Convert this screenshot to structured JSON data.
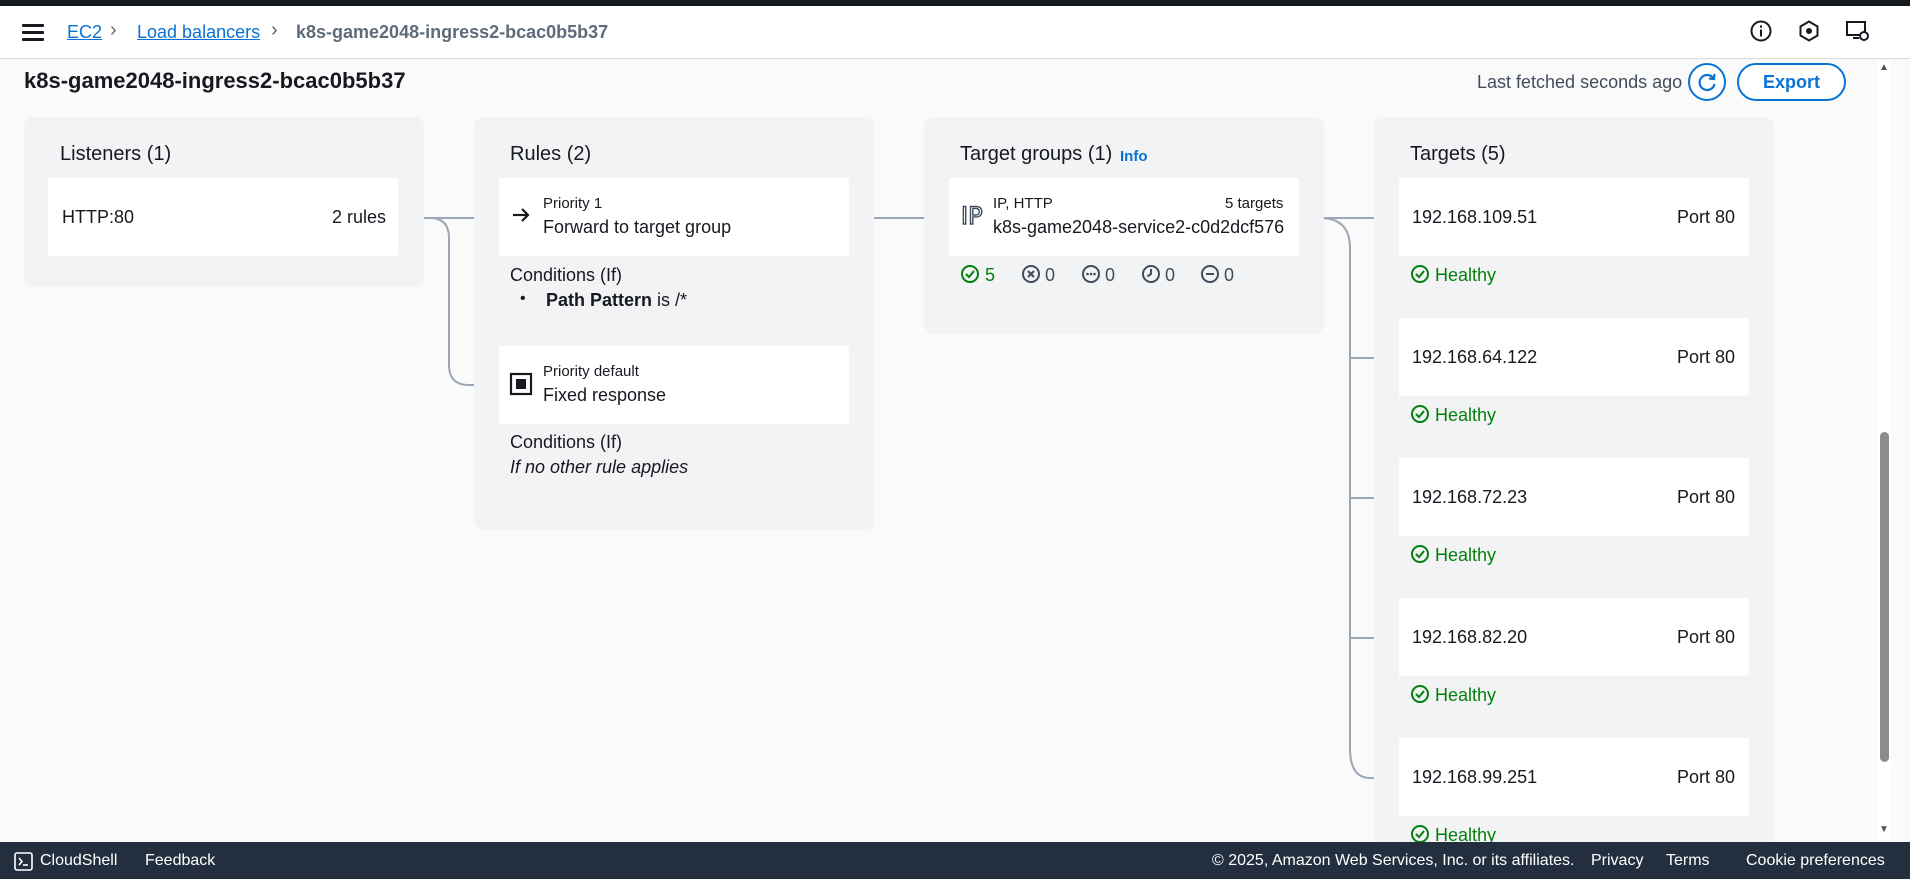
{
  "breadcrumb": {
    "items": [
      "EC2",
      "Load balancers"
    ],
    "current": "k8s-game2048-ingress2-bcac0b5b37"
  },
  "header": {
    "title": "k8s-game2048-ingress2-bcac0b5b37",
    "fetched": "Last fetched seconds ago",
    "export_label": "Export"
  },
  "listeners": {
    "title": "Listeners (1)",
    "items": [
      {
        "protocol": "HTTP:80",
        "rules": "2 rules"
      }
    ]
  },
  "rules": {
    "title": "Rules (2)",
    "items": [
      {
        "priority": "Priority 1",
        "action": "Forward to target group",
        "conditions_title": "Conditions (If)",
        "condition_key": "Path Pattern",
        "condition_op": " is /*"
      },
      {
        "priority": "Priority default",
        "action": "Fixed response",
        "conditions_title": "Conditions (If)",
        "condition_text": "If no other rule applies"
      }
    ]
  },
  "target_groups": {
    "title": "Target groups (1)",
    "info": "Info",
    "items": [
      {
        "type": "IP, HTTP",
        "count": "5 targets",
        "name": "k8s-game2048-service2-c0d2dcf576",
        "icon_text": "IP",
        "status_counts": {
          "healthy": "5",
          "unhealthy": "0",
          "unused": "0",
          "draining": "0",
          "unavailable": "0"
        }
      }
    ]
  },
  "targets": {
    "title": "Targets (5)",
    "items": [
      {
        "ip": "192.168.109.51",
        "port": "Port 80",
        "status": "Healthy"
      },
      {
        "ip": "192.168.64.122",
        "port": "Port 80",
        "status": "Healthy"
      },
      {
        "ip": "192.168.72.23",
        "port": "Port 80",
        "status": "Healthy"
      },
      {
        "ip": "192.168.82.20",
        "port": "Port 80",
        "status": "Healthy"
      },
      {
        "ip": "192.168.99.251",
        "port": "Port 80",
        "status": "Healthy"
      }
    ]
  },
  "footer": {
    "cloudshell": "CloudShell",
    "feedback": "Feedback",
    "copyright": "© 2025, Amazon Web Services, Inc. or its affiliates.",
    "privacy": "Privacy",
    "terms": "Terms",
    "cookies": "Cookie preferences"
  },
  "colors": {
    "link": "#0972d3",
    "healthy": "#037f0c",
    "footer_bg": "#232f3e",
    "column_bg": "#f2f3f4"
  }
}
